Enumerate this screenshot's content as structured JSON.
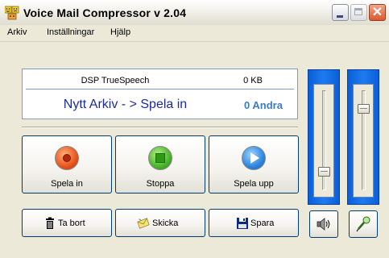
{
  "window": {
    "title": "Voice Mail Compressor  v 2.04"
  },
  "menu": {
    "items": [
      {
        "label": "Arkiv"
      },
      {
        "label": "Inställningar"
      },
      {
        "label": "Hjälp"
      }
    ]
  },
  "display": {
    "codec": "DSP TrueSpeech",
    "size": "0 KB",
    "status": "Nytt Arkiv - > Spela in",
    "seconds": "0 Andra"
  },
  "controls": {
    "record_label": "Spela in",
    "stop_label": "Stoppa",
    "play_label": "Spela upp"
  },
  "actions": {
    "delete_label": "Ta bort",
    "send_label": "Skicka",
    "save_label": "Spara"
  },
  "volume": {
    "speaker_level": 0.15,
    "microphone_level": 0.85
  },
  "colors": {
    "slider_frame": "#1F7BF0",
    "status_text": "#1C2B9E",
    "seconds_text": "#3A7CC8"
  },
  "icons": {
    "app": "faces-icon",
    "record": "record-icon",
    "stop": "stop-icon",
    "play": "play-icon",
    "delete": "trash-icon",
    "send": "envelope-icon",
    "save": "floppy-disk-icon",
    "speaker": "speaker-icon",
    "microphone": "microphone-icon"
  }
}
